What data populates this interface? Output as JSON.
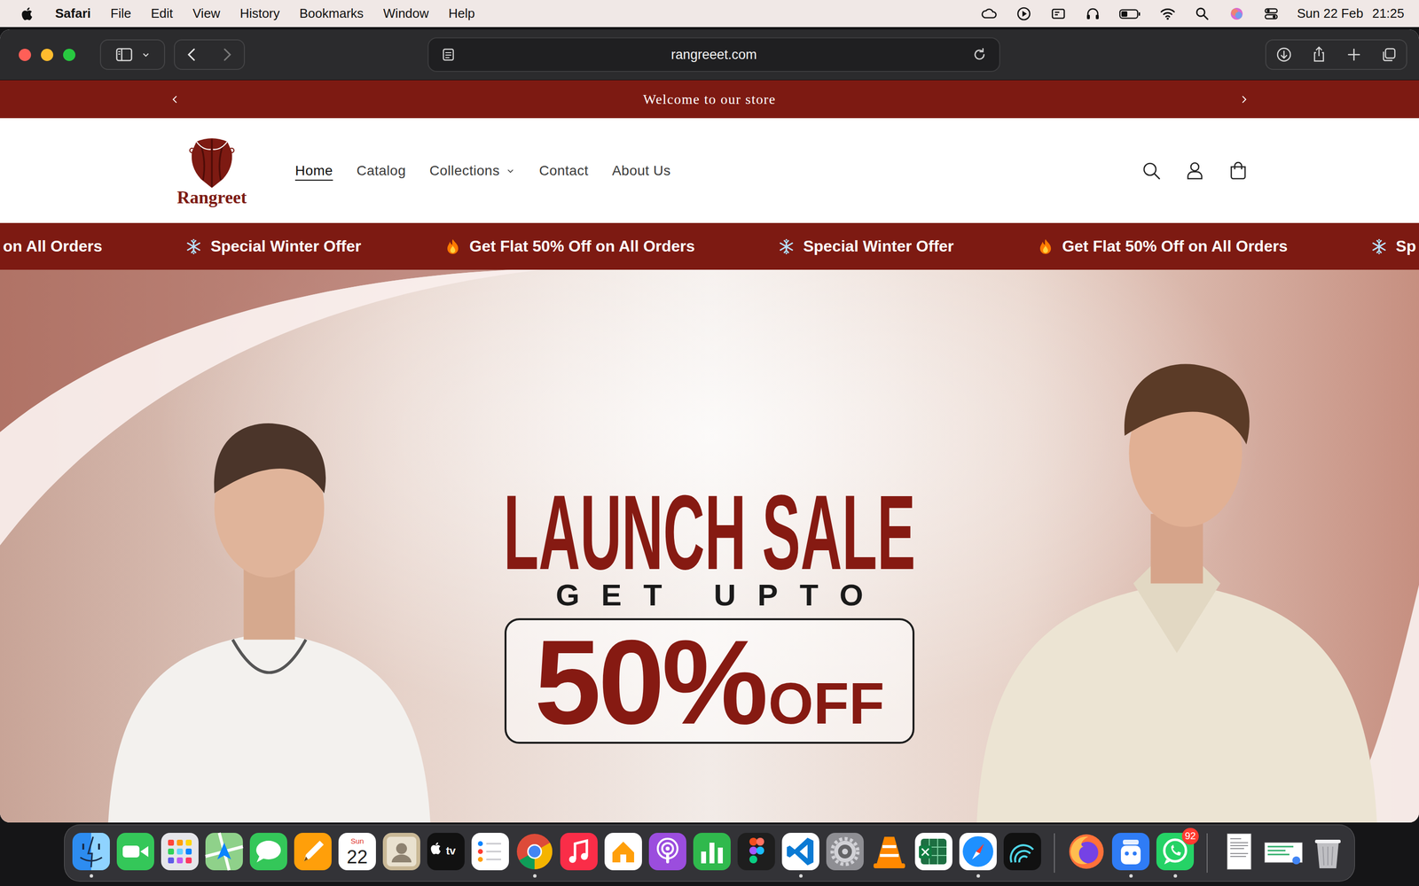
{
  "menubar": {
    "app": "Safari",
    "menus": [
      "File",
      "Edit",
      "View",
      "History",
      "Bookmarks",
      "Window",
      "Help"
    ],
    "date": "Sun 22 Feb",
    "time": "21:25"
  },
  "browser": {
    "url": "rangreeet.com"
  },
  "announcement": {
    "text": "Welcome to our store"
  },
  "store": {
    "brand": "Rangreet",
    "nav": [
      {
        "label": "Home",
        "selected": true,
        "dropdown": false
      },
      {
        "label": "Catalog",
        "selected": false,
        "dropdown": false
      },
      {
        "label": "Collections",
        "selected": false,
        "dropdown": true
      },
      {
        "label": "Contact",
        "selected": false,
        "dropdown": false
      },
      {
        "label": "About Us",
        "selected": false,
        "dropdown": false
      }
    ]
  },
  "marquee": [
    {
      "text": "on All Orders",
      "kind": "plain"
    },
    {
      "text": "Special Winter Offer",
      "kind": "snow"
    },
    {
      "text": "Get Flat 50% Off on All Orders",
      "kind": "fire"
    },
    {
      "text": "Special Winter Offer",
      "kind": "snow"
    },
    {
      "text": "Get Flat 50% Off on All Orders",
      "kind": "fire"
    },
    {
      "text": "Sp",
      "kind": "snow"
    }
  ],
  "hero": {
    "title": "LAUNCH SALE",
    "kicker": "GET UPTO",
    "amount": "50%",
    "suffix": "OFF"
  },
  "dock": {
    "apps": [
      {
        "kind": "finder",
        "color": "#2d8cf0",
        "running": true
      },
      {
        "kind": "facetime",
        "color": "#34c759",
        "running": false
      },
      {
        "kind": "launchpad",
        "color": "#e6e6ea",
        "running": false
      },
      {
        "kind": "maps",
        "color": "#8fd18a",
        "running": false
      },
      {
        "kind": "messages",
        "color": "#34c759",
        "running": false
      },
      {
        "kind": "pages",
        "color": "#ff9f0a",
        "running": false
      },
      {
        "kind": "calendar",
        "color": "#ffffff",
        "running": false,
        "month": "Sun",
        "day": "22"
      },
      {
        "kind": "contacts",
        "color": "#c9b896",
        "running": false
      },
      {
        "kind": "tv",
        "color": "#111111",
        "running": false,
        "label": "tv"
      },
      {
        "kind": "reminders",
        "color": "#ffffff",
        "running": false
      },
      {
        "kind": "chrome",
        "color": "#dd4b39",
        "running": true
      },
      {
        "kind": "music",
        "color": "#fa2d48",
        "running": false
      },
      {
        "kind": "home",
        "color": "#ffffff",
        "running": false
      },
      {
        "kind": "podcasts",
        "color": "#9b4dde",
        "running": false
      },
      {
        "kind": "numbers",
        "color": "#30b94d",
        "running": false
      },
      {
        "kind": "figma",
        "color": "#1e1e1e",
        "running": false
      },
      {
        "kind": "vscode",
        "color": "#ffffff",
        "running": true
      },
      {
        "kind": "settings",
        "color": "#8e8e93",
        "running": false
      },
      {
        "kind": "vlc",
        "color": "#ff8800",
        "running": false
      },
      {
        "kind": "excel",
        "color": "#ffffff",
        "running": false
      },
      {
        "kind": "safari",
        "color": "#ffffff",
        "running": true
      },
      {
        "kind": "wave",
        "color": "#111111",
        "running": false
      }
    ],
    "others": [
      {
        "kind": "firefox",
        "color": "#ff7139",
        "running": false
      },
      {
        "kind": "bluebot",
        "color": "#2f7cf6",
        "running": true
      },
      {
        "kind": "whatsapp",
        "color": "#25d366",
        "running": true,
        "badge": "92"
      }
    ],
    "stack": [
      {
        "kind": "doc",
        "color": "#ffffff",
        "running": false
      },
      {
        "kind": "screenshot",
        "color": "#ffffff",
        "running": false
      },
      {
        "kind": "trash",
        "color": "#d8d8dc",
        "running": false
      }
    ]
  }
}
